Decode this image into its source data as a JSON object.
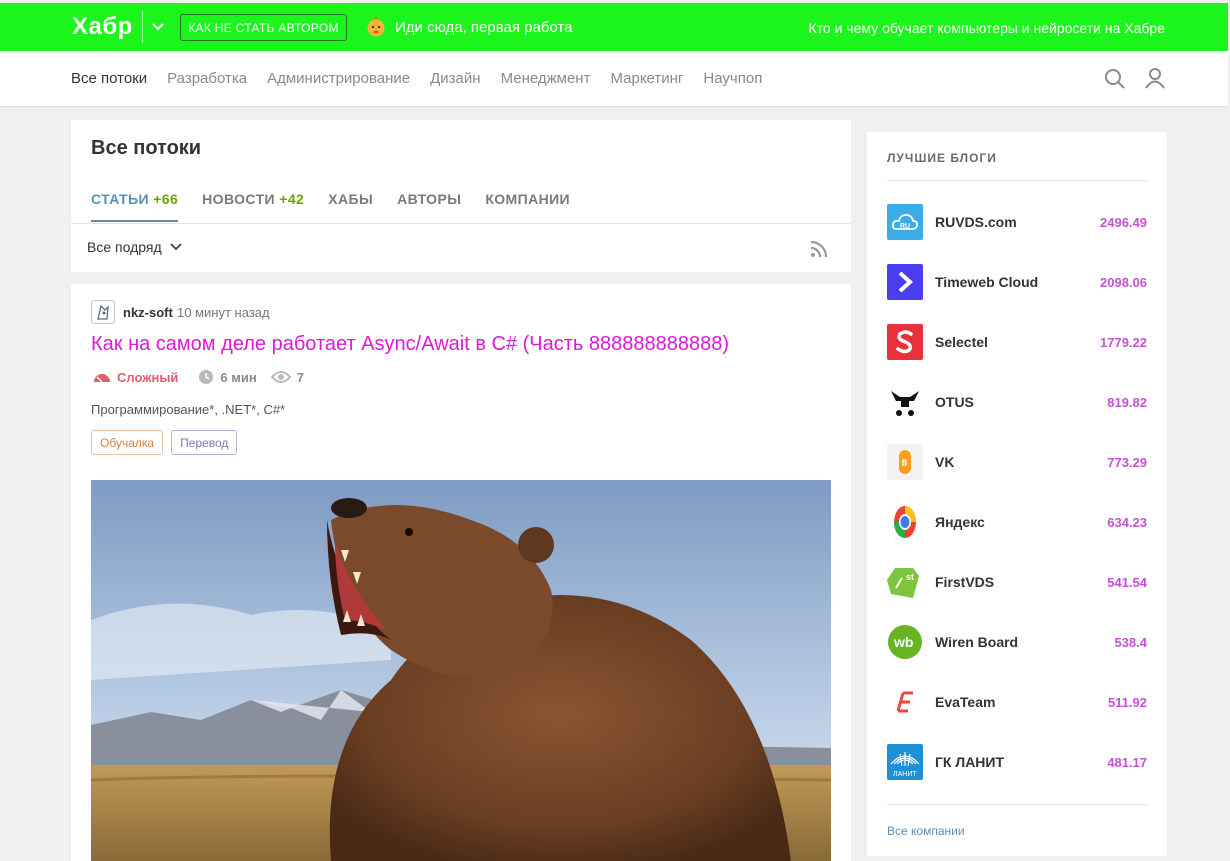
{
  "topbar": {
    "logo": "Хабр",
    "cta": "КАК НЕ СТАТЬ АВТОРОМ",
    "promo": "Иди сюда, первая работа",
    "right_link": "Кто и чему обучает компьютеры и нейросети на Хабре",
    "bg_color": "#1cf51c"
  },
  "nav": {
    "items": [
      "Все потоки",
      "Разработка",
      "Администрирование",
      "Дизайн",
      "Менеджмент",
      "Маркетинг",
      "Научпоп"
    ],
    "active_index": 0
  },
  "feed": {
    "title": "Все потоки",
    "tabs": [
      {
        "label": "СТАТЬИ",
        "count": "+66"
      },
      {
        "label": "НОВОСТИ",
        "count": "+42"
      },
      {
        "label": "ХАБЫ",
        "count": ""
      },
      {
        "label": "АВТОРЫ",
        "count": ""
      },
      {
        "label": "КОМПАНИИ",
        "count": ""
      }
    ],
    "filter": "Все подряд"
  },
  "article": {
    "author": "nkz-soft",
    "time": "10 минут назад",
    "title": "Как на самом деле работает Async/Await в C# (Часть 888888888888)",
    "difficulty": "Сложный",
    "reading_time": "6 мин",
    "views": "7",
    "hubs": "Программирование*, .NET*, C#*",
    "labels": [
      "Обучалка",
      "Перевод"
    ],
    "title_color": "#e018d8"
  },
  "sidebar": {
    "title": "ЛУЧШИЕ БЛОГИ",
    "blogs": [
      {
        "name": "RUVDS.com",
        "rating": "2496.49",
        "icon": "ruvds-logo"
      },
      {
        "name": "Timeweb Cloud",
        "rating": "2098.06",
        "icon": "timeweb-logo"
      },
      {
        "name": "Selectel",
        "rating": "1779.22",
        "icon": "selectel-logo"
      },
      {
        "name": "OTUS",
        "rating": "819.82",
        "icon": "otus-logo"
      },
      {
        "name": "VK",
        "rating": "773.29",
        "icon": "vk-logo"
      },
      {
        "name": "Яндекс",
        "rating": "634.23",
        "icon": "yandex-logo"
      },
      {
        "name": "FirstVDS",
        "rating": "541.54",
        "icon": "firstvds-logo"
      },
      {
        "name": "Wiren Board",
        "rating": "538.4",
        "icon": "wirenboard-logo"
      },
      {
        "name": "EvaTeam",
        "rating": "511.92",
        "icon": "evateam-logo"
      },
      {
        "name": "ГК ЛАНИТ",
        "rating": "481.17",
        "icon": "lanit-logo"
      }
    ],
    "all_link": "Все компании",
    "rating_color": "#c651d4"
  }
}
